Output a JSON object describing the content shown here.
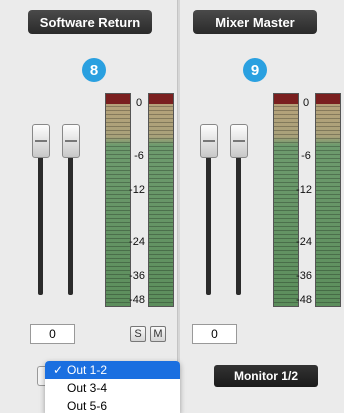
{
  "channels": [
    {
      "title": "Software Return",
      "badge": "8",
      "value": "0",
      "solo_label": "S",
      "mute_label": "M",
      "output_menu": {
        "options": [
          "Out 1-2",
          "Out 3-4",
          "Out 5-6"
        ],
        "selected": "Out 1-2",
        "check": "✓"
      },
      "fader_levels": [
        0.72,
        0.72
      ]
    },
    {
      "title": "Mixer Master",
      "badge": "9",
      "value": "0",
      "monitor_label": "Monitor 1/2",
      "fader_levels": [
        0.72,
        0.72
      ]
    }
  ],
  "meter_scale": [
    "0",
    "-6",
    "-12",
    "-24",
    "-36",
    "-48"
  ],
  "colors": {
    "badge": "#2aa0e0",
    "title_bg": "#2f2f2f",
    "menu_highlight": "#1a6fe0",
    "peak": "#7a1f1f",
    "meter_green": "#5c8e5c"
  }
}
